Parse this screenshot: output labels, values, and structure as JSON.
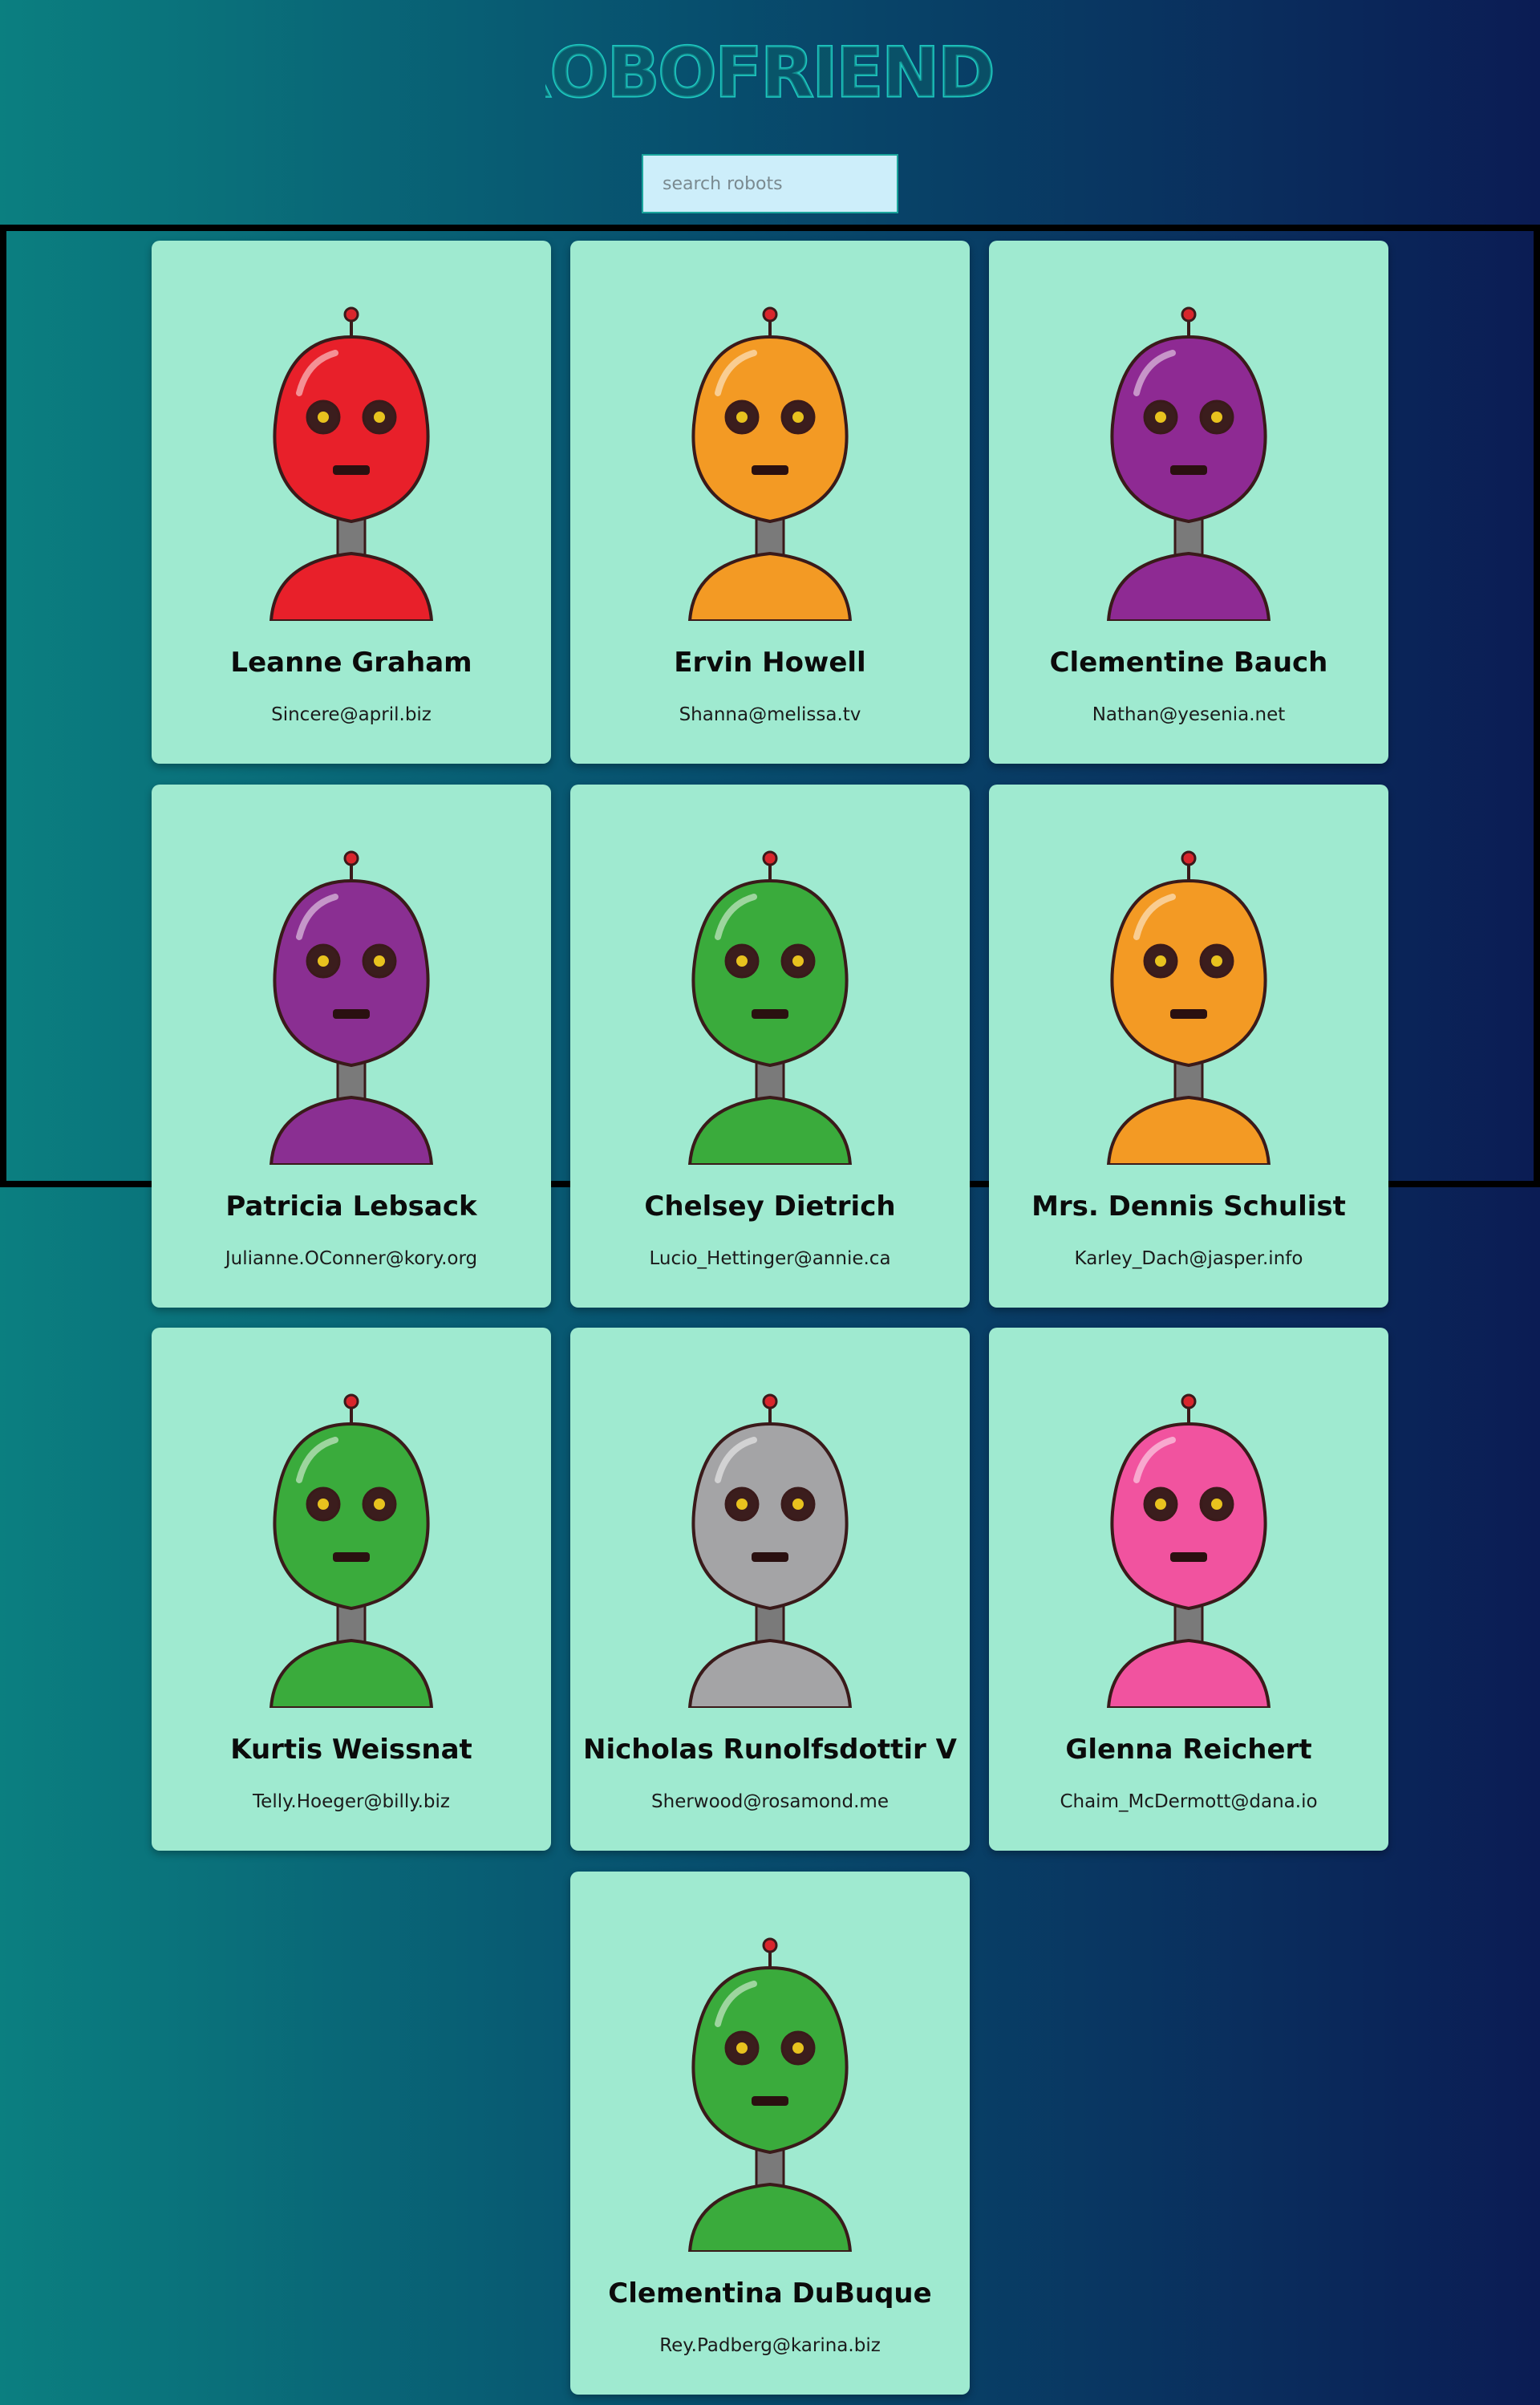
{
  "app": {
    "title": "ROBOFRIENDS",
    "title_color": "#1ec8c0"
  },
  "search": {
    "placeholder": "search robots",
    "value": ""
  },
  "colors": {
    "card_background": "#9fead0",
    "search_background": "#cdeefa",
    "frame_border": "#000000"
  },
  "robots": [
    {
      "name": "Leanne Graham",
      "email": "Sincere@april.biz",
      "color": "#e8202a",
      "avatar": "robot-avatar"
    },
    {
      "name": "Ervin Howell",
      "email": "Shanna@melissa.tv",
      "color": "#f39a24",
      "avatar": "robot-avatar"
    },
    {
      "name": "Clementine Bauch",
      "email": "Nathan@yesenia.net",
      "color": "#8e2a93",
      "avatar": "robot-avatar"
    },
    {
      "name": "Patricia Lebsack",
      "email": "Julianne.OConner@kory.org",
      "color": "#8a2f92",
      "avatar": "robot-avatar"
    },
    {
      "name": "Chelsey Dietrich",
      "email": "Lucio_Hettinger@annie.ca",
      "color": "#3aab3c",
      "avatar": "robot-avatar"
    },
    {
      "name": "Mrs. Dennis Schulist",
      "email": "Karley_Dach@jasper.info",
      "color": "#f39a24",
      "avatar": "robot-avatar"
    },
    {
      "name": "Kurtis Weissnat",
      "email": "Telly.Hoeger@billy.biz",
      "color": "#3aab3c",
      "avatar": "robot-avatar"
    },
    {
      "name": "Nicholas Runolfsdottir V",
      "email": "Sherwood@rosamond.me",
      "color": "#a4a4a6",
      "avatar": "robot-avatar"
    },
    {
      "name": "Glenna Reichert",
      "email": "Chaim_McDermott@dana.io",
      "color": "#f1539f",
      "avatar": "robot-avatar"
    },
    {
      "name": "Clementina DuBuque",
      "email": "Rey.Padberg@karina.biz",
      "color": "#3aab3c",
      "avatar": "robot-avatar"
    }
  ]
}
